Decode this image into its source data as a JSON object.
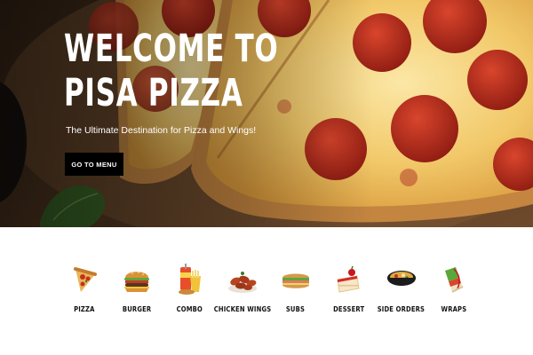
{
  "hero": {
    "title_line1": "WELCOME TO",
    "title_line2": "PISA PIZZA",
    "subtitle": "The Ultimate Destination for Pizza and Wings!",
    "cta_label": "GO TO MENU"
  },
  "categories": [
    {
      "label": "PIZZA",
      "icon": "pizza-slice-icon"
    },
    {
      "label": "BURGER",
      "icon": "burger-icon"
    },
    {
      "label": "COMBO",
      "icon": "combo-meal-icon"
    },
    {
      "label": "CHICKEN WINGS",
      "icon": "chicken-wings-icon"
    },
    {
      "label": "SUBS",
      "icon": "sub-sandwich-icon"
    },
    {
      "label": "DESSERT",
      "icon": "cake-slice-icon"
    },
    {
      "label": "SIDE ORDERS",
      "icon": "side-bowl-icon"
    },
    {
      "label": "WRAPS",
      "icon": "wrap-icon"
    }
  ],
  "colors": {
    "cta_background": "#000000",
    "cta_text": "#ffffff",
    "hero_text": "#ffffff",
    "category_text": "#111111"
  }
}
